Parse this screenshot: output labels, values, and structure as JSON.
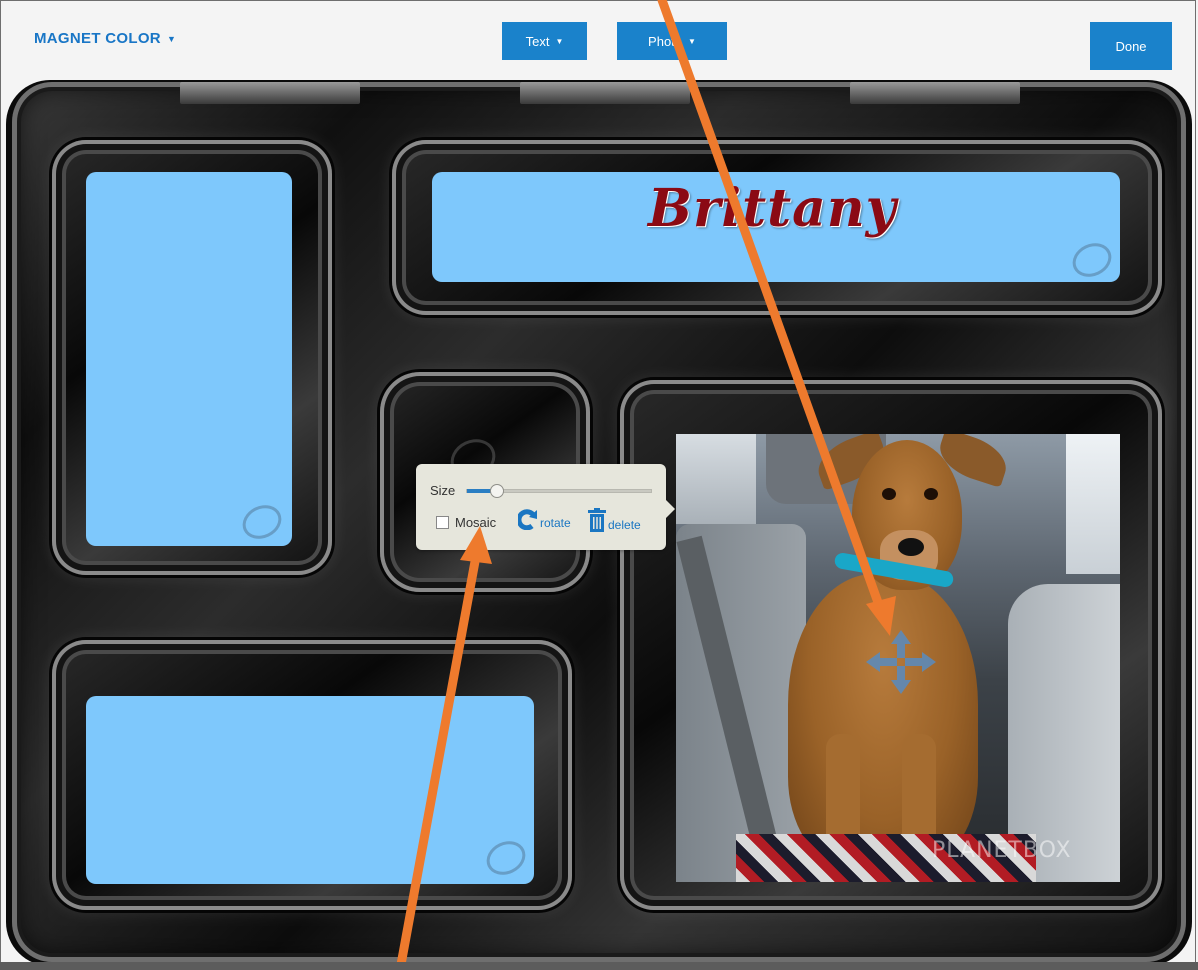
{
  "toolbar": {
    "magnet_color_label": "MAGNET COLOR",
    "text_label": "Text",
    "photo_label": "Photo",
    "done_label": "Done"
  },
  "canvas": {
    "name_text": "Brittany",
    "photo_watermark": "PLANETBOX",
    "magnet_color": "#7ec8fc",
    "name_color": "#8b0a14"
  },
  "popup": {
    "size_label": "Size",
    "size_value": 0.16,
    "mosaic_label": "Mosaic",
    "mosaic_checked": false,
    "rotate_label": "rotate",
    "delete_label": "delete"
  },
  "annotations": {
    "arrow_color": "#ee7a2d"
  },
  "icons": [
    "caret-down-icon",
    "planet-logo-icon",
    "move-arrows-icon",
    "rotate-icon",
    "trash-icon"
  ]
}
